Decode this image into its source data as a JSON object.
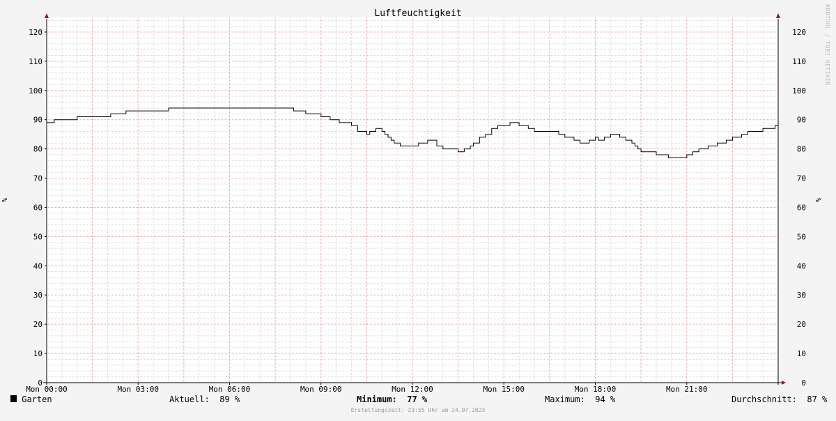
{
  "chart_data": {
    "type": "line",
    "title": "Luftfeuchtigkeit",
    "ylabel": "%",
    "ylabel_right": "%",
    "ylim": [
      0,
      125
    ],
    "yticks": [
      0,
      10,
      20,
      30,
      40,
      50,
      60,
      70,
      80,
      90,
      100,
      110,
      120
    ],
    "xlim": [
      0,
      24
    ],
    "xticks": [
      {
        "value": 0,
        "label": "Mon 00:00"
      },
      {
        "value": 3,
        "label": "Mon 03:00"
      },
      {
        "value": 6,
        "label": "Mon 06:00"
      },
      {
        "value": 9,
        "label": "Mon 09:00"
      },
      {
        "value": 12,
        "label": "Mon 12:00"
      },
      {
        "value": 15,
        "label": "Mon 15:00"
      },
      {
        "value": 18,
        "label": "Mon 18:00"
      },
      {
        "value": 21,
        "label": "Mon 21:00"
      }
    ],
    "grid": true,
    "series": [
      {
        "name": "Garten",
        "color": "#000000",
        "x": [
          0,
          0.25,
          1.0,
          2.1,
          2.6,
          4.0,
          4.8,
          5.5,
          6.0,
          7.0,
          8.1,
          8.5,
          9.0,
          9.3,
          9.6,
          10.0,
          10.2,
          10.5,
          10.6,
          10.8,
          11.0,
          11.1,
          11.2,
          11.3,
          11.4,
          11.6,
          12.0,
          12.2,
          12.5,
          12.8,
          13.0,
          13.5,
          13.7,
          13.9,
          14.0,
          14.2,
          14.4,
          14.6,
          14.8,
          15.2,
          15.5,
          15.8,
          16.0,
          16.2,
          16.4,
          16.5,
          16.6,
          16.8,
          17.0,
          17.1,
          17.3,
          17.5,
          17.8,
          18.0,
          18.1,
          18.3,
          18.5,
          18.8,
          19.0,
          19.2,
          19.3,
          19.4,
          19.5,
          20.0,
          20.4,
          20.6,
          20.8,
          21.0,
          21.2,
          21.4,
          21.7,
          22.0,
          22.3,
          22.5,
          22.8,
          23.0,
          23.5,
          23.9,
          24.0
        ],
        "values": [
          89,
          90,
          91,
          92,
          93,
          94,
          94,
          94,
          94,
          94,
          93,
          92,
          91,
          90,
          89,
          88,
          86,
          85,
          86,
          87,
          86,
          85,
          84,
          83,
          82,
          81,
          81,
          82,
          83,
          81,
          80,
          79,
          80,
          81,
          82,
          84,
          85,
          87,
          88,
          89,
          88,
          87,
          86,
          86,
          86,
          86,
          86,
          85,
          84,
          84,
          83,
          82,
          83,
          84,
          83,
          84,
          85,
          84,
          83,
          82,
          81,
          80,
          79,
          78,
          77,
          77,
          77,
          78,
          79,
          80,
          81,
          82,
          83,
          84,
          85,
          86,
          87,
          88,
          89
        ]
      }
    ],
    "legend": [
      {
        "label": "Garten",
        "color": "#000000"
      }
    ],
    "stats": {
      "current": "Aktuell:  89 %",
      "min": "Minimum:  77 %",
      "max": "Maximum:  94 %",
      "avg": "Durchschnitt:  87 %"
    },
    "credit": "Erstellungszeit: 23:55 Uhr am 24.07.2023",
    "watermark": "RRDTOOL / TOBI OETIKER"
  }
}
